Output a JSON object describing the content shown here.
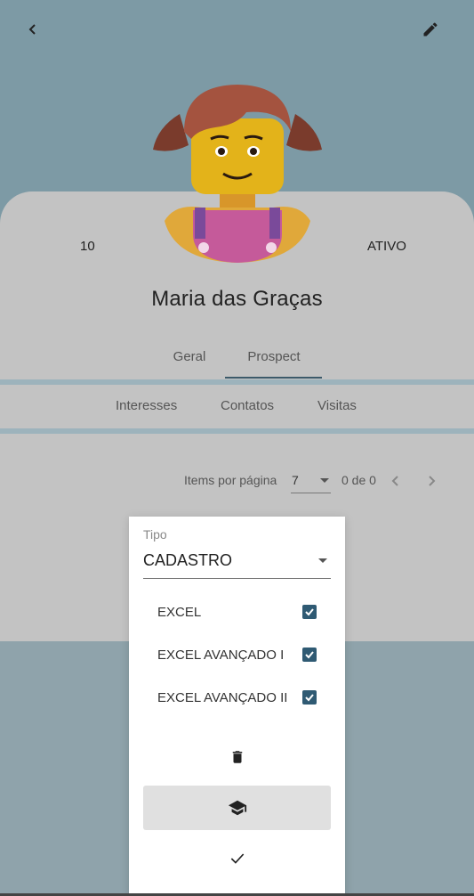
{
  "header": {
    "back_icon": "chevron-left-icon",
    "edit_icon": "pencil-icon"
  },
  "profile": {
    "name": "Maria das Graças",
    "left_stat": "10",
    "right_stat": "ATIVO"
  },
  "tabs": [
    {
      "label": "Geral",
      "active": false
    },
    {
      "label": "Prospect",
      "active": true
    }
  ],
  "subtabs": [
    {
      "label": "Interesses"
    },
    {
      "label": "Contatos"
    },
    {
      "label": "Visitas"
    }
  ],
  "paginator": {
    "items_label": "Items por página",
    "page_size": "7",
    "range": "0 de 0"
  },
  "panel": {
    "tipo_label": "Tipo",
    "tipo_value": "CADASTRO",
    "options": [
      {
        "label": "EXCEL",
        "checked": true
      },
      {
        "label": "EXCEL AVANÇADO I",
        "checked": true
      },
      {
        "label": "EXCEL AVANÇADO II",
        "checked": true
      }
    ],
    "delete_icon": "trash-icon",
    "course_icon": "graduation-cap-icon",
    "confirm_icon": "check-icon"
  },
  "colors": {
    "accent": "#2f5a73",
    "tab_underline": "#3c5a6a",
    "card": "#c3c3c3"
  }
}
